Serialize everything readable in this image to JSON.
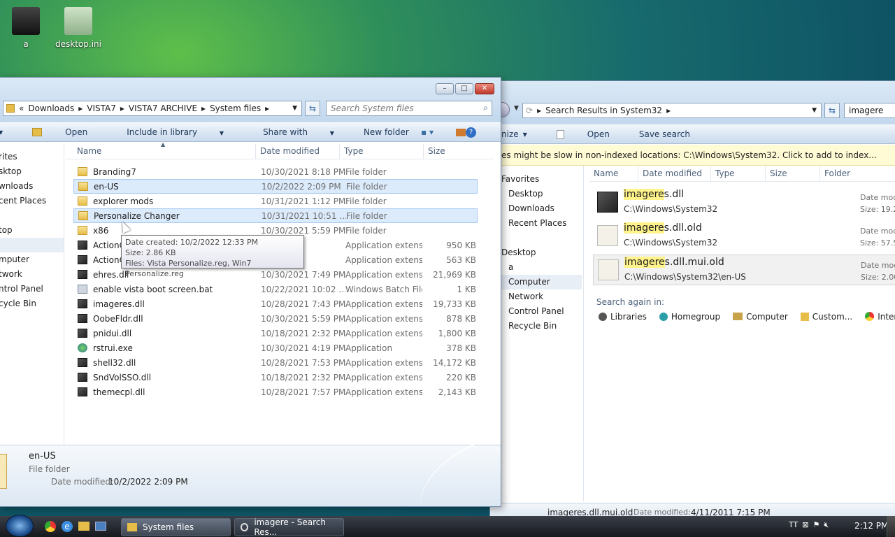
{
  "desktop": {
    "icons": [
      {
        "label": "a"
      },
      {
        "label": "desktop.ini"
      }
    ]
  },
  "win1": {
    "breadcrumb": [
      "«",
      "Downloads",
      "VISTA7",
      "VISTA7 ARCHIVE",
      "System files"
    ],
    "search_placeholder": "Search System files",
    "toolbar": {
      "open": "Open",
      "include": "Include in library",
      "share": "Share with",
      "newfolder": "New folder"
    },
    "columns": {
      "name": "Name",
      "date": "Date modified",
      "type": "Type",
      "size": "Size"
    },
    "nav": [
      "rites",
      "sktop",
      "wnloads",
      "cent Places",
      "",
      "top",
      "",
      "mputer",
      "twork",
      "ntrol Panel",
      "cycle Bin"
    ],
    "files": [
      {
        "name": "Branding7",
        "date": "10/30/2021 8:18 PM",
        "type": "File folder",
        "size": "",
        "icon": "fold"
      },
      {
        "name": "en-US",
        "date": "10/2/2022 2:09 PM",
        "type": "File folder",
        "size": "",
        "icon": "fold"
      },
      {
        "name": "explorer mods",
        "date": "10/31/2021 1:12 PM",
        "type": "File folder",
        "size": "",
        "icon": "fold"
      },
      {
        "name": "Personalize Changer",
        "date": "10/31/2021 10:51 ...",
        "type": "File folder",
        "size": "",
        "icon": "fold"
      },
      {
        "name": "x86",
        "date": "10/30/2021 5:59 PM",
        "type": "File folder",
        "size": "",
        "icon": "fold"
      },
      {
        "name": "ActionC",
        "date": "24 PM",
        "type": "Application extens...",
        "size": "950 KB",
        "icon": "dll"
      },
      {
        "name": "ActionC",
        "date": "24 PM",
        "type": "Application extens...",
        "size": "563 KB",
        "icon": "dll"
      },
      {
        "name": "ehres.dll",
        "date": "10/30/2021 7:49 PM",
        "type": "Application extens...",
        "size": "21,969 KB",
        "icon": "dll"
      },
      {
        "name": "enable vista boot screen.bat",
        "date": "10/22/2021 10:02 ...",
        "type": "Windows Batch File",
        "size": "1 KB",
        "icon": "bat"
      },
      {
        "name": "imageres.dll",
        "date": "10/28/2021 7:43 PM",
        "type": "Application extens...",
        "size": "19,733 KB",
        "icon": "dll"
      },
      {
        "name": "OobeFldr.dll",
        "date": "10/30/2021 5:59 PM",
        "type": "Application extens...",
        "size": "878 KB",
        "icon": "dll"
      },
      {
        "name": "pnidui.dll",
        "date": "10/18/2021 2:32 PM",
        "type": "Application extens...",
        "size": "1,800 KB",
        "icon": "dll"
      },
      {
        "name": "rstrui.exe",
        "date": "10/30/2021 4:19 PM",
        "type": "Application",
        "size": "378 KB",
        "icon": "exe"
      },
      {
        "name": "shell32.dll",
        "date": "10/28/2021 7:53 PM",
        "type": "Application extens...",
        "size": "14,172 KB",
        "icon": "dll"
      },
      {
        "name": "SndVolSSO.dll",
        "date": "10/18/2021 2:32 PM",
        "type": "Application extens...",
        "size": "220 KB",
        "icon": "dll"
      },
      {
        "name": "themecpl.dll",
        "date": "10/28/2021 7:57 PM",
        "type": "Application extens...",
        "size": "2,143 KB",
        "icon": "dll"
      }
    ],
    "tooltip": {
      "l1": "Date created: 10/2/2022 12:33 PM",
      "l2": "Size: 2.86 KB",
      "l3": "Files: Vista Personalize.reg, Win7 Personalize.reg"
    },
    "details": {
      "name": "en-US",
      "type": "File folder",
      "date_label": "Date modified:",
      "date": "10/2/2022 2:09 PM"
    }
  },
  "win2": {
    "breadcrumb": "Search Results in System32",
    "search_value": "imagere",
    "toolbar": {
      "organize": "nize",
      "open": "Open",
      "save": "Save search"
    },
    "infobar": "es might be slow in non-indexed locations: C:\\Windows\\System32. Click to add to index...",
    "columns": {
      "name": "Name",
      "date": "Date modified",
      "type": "Type",
      "size": "Size",
      "folder": "Folder"
    },
    "nav": [
      "Favorites",
      "Desktop",
      "Downloads",
      "Recent Places",
      "",
      "Desktop",
      "a",
      "Computer",
      "Network",
      "Control Panel",
      "Recycle Bin"
    ],
    "results": [
      {
        "hl": "imagere",
        "rest": "s.dll",
        "path": "C:\\Windows\\System32",
        "m1": "Date mod",
        "m2": "Size: 19.2"
      },
      {
        "hl": "imagere",
        "rest": "s.dll.old",
        "path": "C:\\Windows\\System32",
        "m1": "Date mod",
        "m2": "Size: 57.5"
      },
      {
        "hl": "imagere",
        "rest": "s.dll.mui.old",
        "path": "C:\\Windows\\System32\\en-US",
        "m1": "Date mod",
        "m2": "Size: 2.00"
      }
    ],
    "search_again": "Search again in:",
    "search_targets": [
      "Libraries",
      "Homegroup",
      "Computer",
      "Custom...",
      "Internet"
    ],
    "details": {
      "name": "imageres.dll.mui.old",
      "date_label": "Date modified:",
      "date": "4/11/2011 7:15 PM"
    }
  },
  "taskbar": {
    "btn1": "System files",
    "btn2": "imagere - Search Res...",
    "clock": "2:12 PM"
  }
}
